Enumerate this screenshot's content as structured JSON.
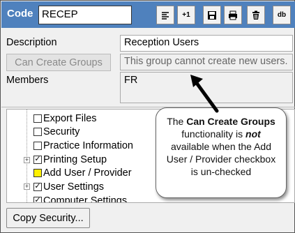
{
  "header": {
    "code_label": "Code",
    "code_value": "RECEP",
    "toolbar": [
      {
        "name": "align-icon",
        "label": ""
      },
      {
        "name": "plus-one-button",
        "label": "+1"
      },
      {
        "name": "save-icon",
        "label": ""
      },
      {
        "name": "print-icon",
        "label": ""
      },
      {
        "name": "trash-icon",
        "label": ""
      },
      {
        "name": "db-button",
        "label": "db"
      }
    ]
  },
  "form": {
    "description_label": "Description",
    "description_value": "Reception Users",
    "can_create_groups_label": "Can Create Groups",
    "can_create_groups_value": "This group cannot create new users.",
    "members_label": "Members",
    "members_value": "FR"
  },
  "tree": {
    "items": [
      {
        "label": "Export Files",
        "checked": false
      },
      {
        "label": "Security",
        "checked": false
      },
      {
        "label": "Practice Information",
        "checked": false
      },
      {
        "label": "Printing Setup",
        "checked": true
      },
      {
        "label": "Add User / Provider",
        "checked": false
      },
      {
        "label": "User Settings",
        "checked": true
      },
      {
        "label": "Computer Settings",
        "checked": true
      }
    ]
  },
  "callout": {
    "line1_pre": "The ",
    "line1_bold": "Can Create Groups",
    "line1_post": " functionality is ",
    "line2_bolditalic": "not",
    "line2_post": " available when the Add User / Provider checkbox is un-checked"
  },
  "footer": {
    "copy_security_label": "Copy Security..."
  },
  "colors": {
    "header": "#4f81bd",
    "highlight": "#fff000"
  }
}
